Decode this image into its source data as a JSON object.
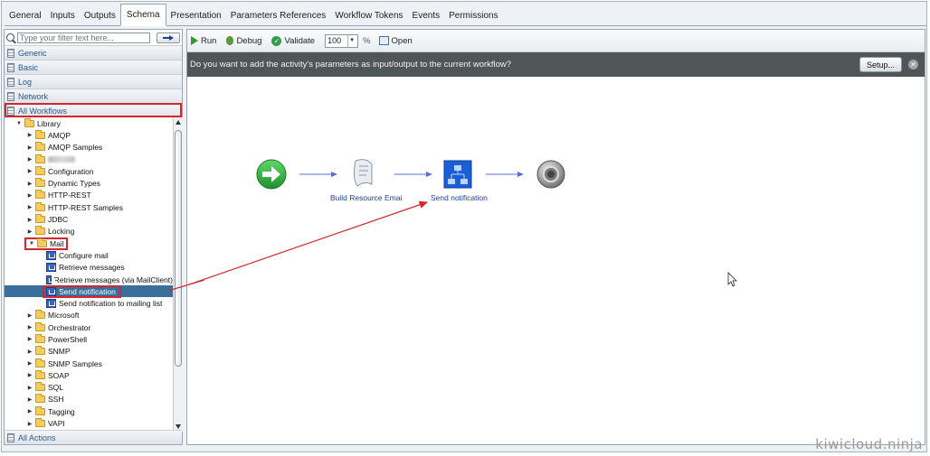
{
  "tabs": [
    "General",
    "Inputs",
    "Outputs",
    "Schema",
    "Presentation",
    "Parameters References",
    "Workflow Tokens",
    "Events",
    "Permissions"
  ],
  "active_tab": "Schema",
  "filter": {
    "placeholder": "Type your filter text here..."
  },
  "categories": [
    "Generic",
    "Basic",
    "Log",
    "Network",
    "All Workflows"
  ],
  "bottom_category": "All Actions",
  "tree": {
    "root": "Library",
    "folders_top": [
      "AMQP",
      "AMQP Samples",
      "",
      "Configuration",
      "Dynamic Types",
      "HTTP-REST",
      "HTTP-REST Samples",
      "JDBC",
      "Locking"
    ],
    "mail_folder": "Mail",
    "mail_items": [
      "Configure mail",
      "Retrieve messages",
      "Retrieve messages (via MailClient)",
      "Send notification",
      "Send notification to mailing list"
    ],
    "folders_bottom": [
      "Microsoft",
      "Orchestrator",
      "PowerShell",
      "SNMP",
      "SNMP Samples",
      "SOAP",
      "SQL",
      "SSH",
      "Tagging",
      "VAPI"
    ]
  },
  "toolbar": {
    "run": "Run",
    "debug": "Debug",
    "validate": "Validate",
    "zoom": "100",
    "percent": "%",
    "open": "Open"
  },
  "banner": {
    "message": "Do you want to add the activity's parameters as input/output to the current workflow?",
    "setup": "Setup..."
  },
  "schema": {
    "nodes": [
      "Build Resource Emai",
      "Send notification"
    ]
  },
  "watermark": "kiwicloud.ninja",
  "colors": {
    "selection": "#3a6f9b",
    "highlight_box": "#d3262f",
    "banner_bg": "#505558",
    "link": "#1f3f95"
  }
}
